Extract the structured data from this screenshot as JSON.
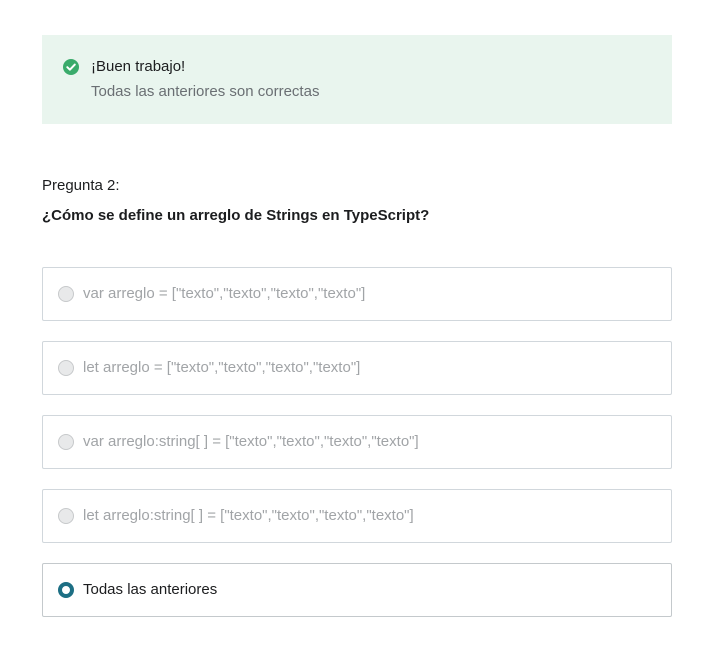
{
  "feedback": {
    "title": "¡Buen trabajo!",
    "message": "Todas las anteriores son correctas",
    "icon": "check-circle-icon",
    "accent_color": "#3aab6b",
    "background_color": "#e9f5ee"
  },
  "question": {
    "number_label": "Pregunta 2:",
    "text": "¿Cómo se define un arreglo de Strings en TypeScript?"
  },
  "options": [
    {
      "label": "var arreglo = [\"texto\",\"texto\",\"texto\",\"texto\"]",
      "selected": false
    },
    {
      "label": "let arreglo = [\"texto\",\"texto\",\"texto\",\"texto\"]",
      "selected": false
    },
    {
      "label": "var arreglo:string[ ] = [\"texto\",\"texto\",\"texto\",\"texto\"]",
      "selected": false
    },
    {
      "label": "let arreglo:string[ ] = [\"texto\",\"texto\",\"texto\",\"texto\"]",
      "selected": false
    },
    {
      "label": "Todas las anteriores",
      "selected": true
    }
  ],
  "colors": {
    "selected_radio": "#1d6f84",
    "disabled_text": "#a1a4a7",
    "border": "#d1d7dc"
  }
}
